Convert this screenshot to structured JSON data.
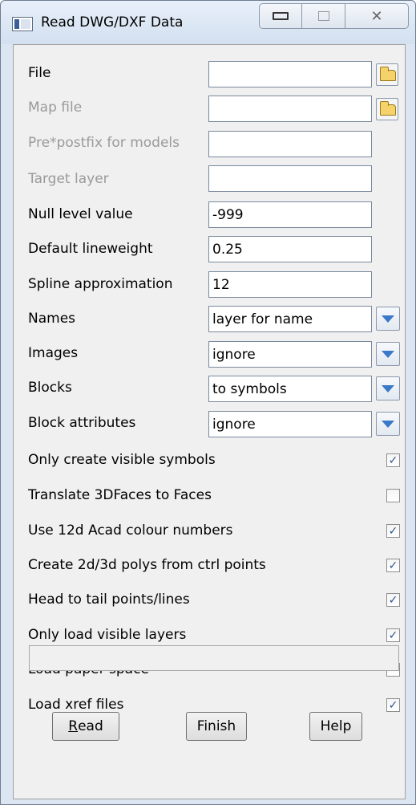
{
  "window": {
    "title": "Read DWG/DXF Data",
    "icon": "app-window-icon",
    "controls": {
      "minimize": "minimize-icon",
      "maximize": "maximize-icon",
      "close": "✕"
    }
  },
  "fields": {
    "file": {
      "label": "File",
      "value": ""
    },
    "map_file": {
      "label": "Map file",
      "value": ""
    },
    "prefix": {
      "label": "Pre*postfix for models",
      "value": ""
    },
    "target_layer": {
      "label": "Target layer",
      "value": ""
    },
    "null_level": {
      "label": "Null level value",
      "value": "-999"
    },
    "lineweight": {
      "label": "Default lineweight",
      "value": "0.25"
    },
    "spline": {
      "label": "Spline approximation",
      "value": "12"
    }
  },
  "dropdowns": {
    "names": {
      "label": "Names",
      "value": "layer for name"
    },
    "images": {
      "label": "Images",
      "value": "ignore"
    },
    "blocks": {
      "label": "Blocks",
      "value": "to symbols"
    },
    "block_attributes": {
      "label": "Block attributes",
      "value": "ignore"
    }
  },
  "checkboxes": {
    "only_visible_symbols": {
      "label": "Only create visible symbols",
      "checked": true
    },
    "translate_3dfaces": {
      "label": "Translate 3DFaces to Faces",
      "checked": false
    },
    "use_12d_colours": {
      "label": "Use 12d Acad colour numbers",
      "checked": true
    },
    "create_polys": {
      "label": "Create 2d/3d polys from ctrl points",
      "checked": true
    },
    "head_to_tail": {
      "label": "Head to tail points/lines",
      "checked": true
    },
    "only_visible_layers": {
      "label": "Only load visible layers",
      "checked": true
    },
    "paper_space": {
      "label": "Load paper space",
      "checked": false
    },
    "xref_files": {
      "label": "Load xref files",
      "checked": true
    }
  },
  "status_text": "",
  "buttons": {
    "read": {
      "mnemonic": "R",
      "rest": "ead"
    },
    "finish": "Finish",
    "help": "Help"
  },
  "colors": {
    "checkmark": "#2b5592",
    "dropdown_arrow": "#3a78c8",
    "disabled_text": "#9a9a9a",
    "title_bg": "#dce6f2"
  }
}
